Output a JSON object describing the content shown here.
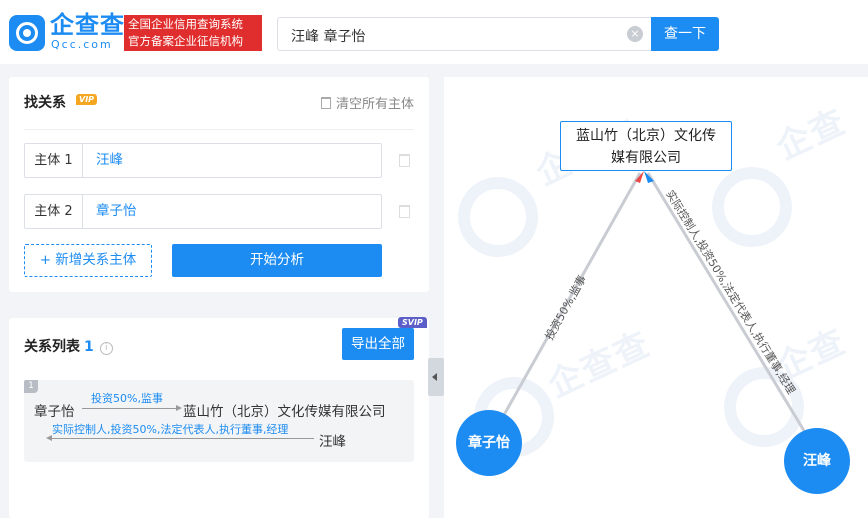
{
  "header": {
    "logo_cn": "企查查",
    "logo_en": "Qcc.com",
    "badge_line1": "全国企业信用查询系统",
    "badge_line2": "官方备案企业征信机构",
    "search_value": "汪峰 章子怡",
    "search_button": "查一下"
  },
  "find_relation": {
    "title": "找关系",
    "vip_badge": "VIP",
    "clear_all": "清空所有主体",
    "entities": [
      {
        "label": "主体 1",
        "value": "汪峰"
      },
      {
        "label": "主体 2",
        "value": "章子怡"
      }
    ],
    "add_button": "+ 新增关系主体",
    "start_button": "开始分析"
  },
  "relation_list": {
    "title": "关系列表",
    "count": "1",
    "svip_badge": "SVIP",
    "export_button": "导出全部",
    "items": [
      {
        "num": "1",
        "from": "章子怡",
        "label1": "投资50%,监事",
        "company": "蓝山竹（北京）文化传媒有限公司",
        "label2": "实际控制人,投资50%,法定代表人,执行董事,经理",
        "to": "汪峰"
      }
    ]
  },
  "graph": {
    "company_line1": "蓝山竹（北京）文化传",
    "company_line2": "媒有限公司",
    "node_left": "章子怡",
    "node_right": "汪峰",
    "edge_left_label": "投资50%,监事",
    "edge_right_label": "实际控制人,投资50%,法定代表人,执行董事,经理",
    "accent": "#1d8cf2"
  }
}
